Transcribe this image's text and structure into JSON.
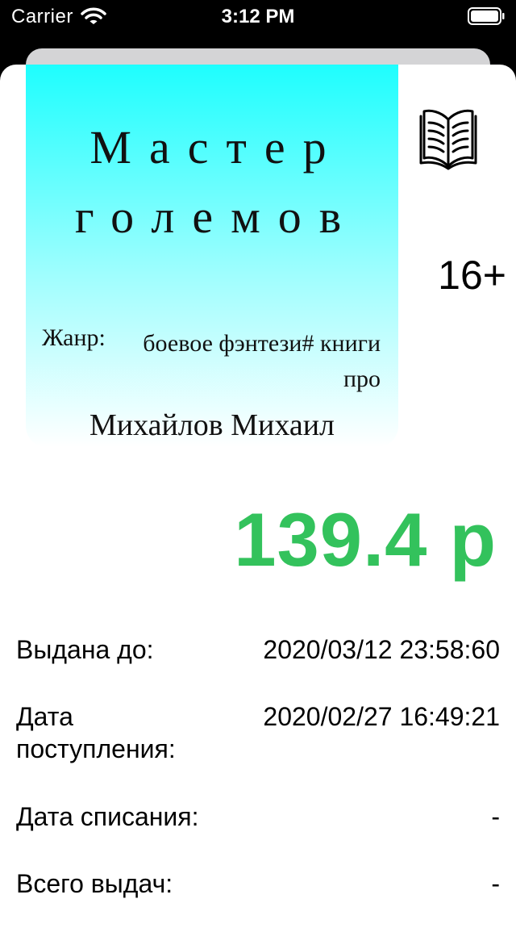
{
  "status_bar": {
    "carrier": "Carrier",
    "time": "3:12 PM",
    "wifi_icon": "wifi-icon",
    "battery_icon": "battery-icon"
  },
  "book": {
    "cover": {
      "title": "Мастер големов",
      "genre_label": "Жанр:",
      "genre_value": "боевое фэнтези# книги про",
      "author": "Михайлов Михаил",
      "colors": {
        "top": "#1efefe",
        "bottom": "#ffffff"
      }
    },
    "type_icon": "open-book-icon",
    "age_rating": "16+",
    "price": "139.4 р",
    "price_color": "#33c25c"
  },
  "details": {
    "due_date": {
      "label": "Выдана до:",
      "value": "2020/03/12 23:58:60"
    },
    "arrival_date": {
      "label": "Дата поступления:",
      "value": "2020/02/27 16:49:21"
    },
    "writeoff_date": {
      "label": "Дата списания:",
      "value": "-"
    },
    "total_loans": {
      "label": "Всего выдач:",
      "value": "-"
    }
  }
}
